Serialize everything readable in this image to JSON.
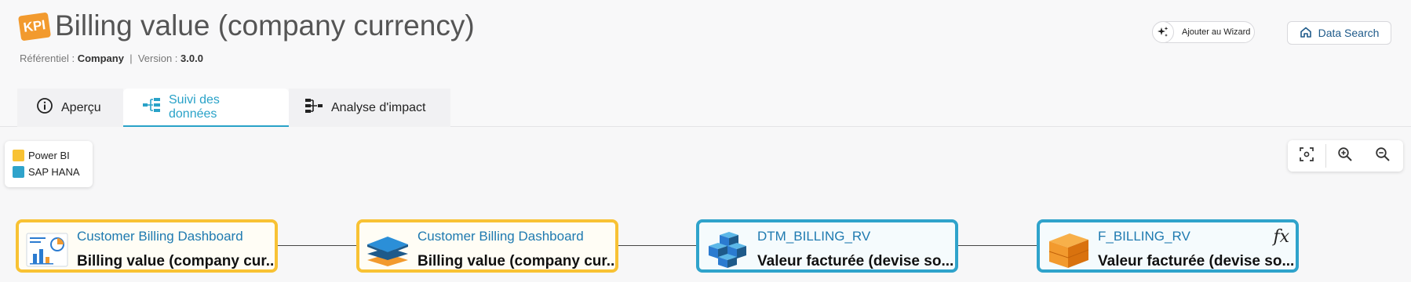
{
  "header": {
    "kpi_badge": "KPI",
    "title": "Billing value (company currency)",
    "referentiel_label": "Référentiel :",
    "referentiel_value": "Company",
    "separator": "|",
    "version_label": "Version :",
    "version_value": "3.0.0"
  },
  "actions": {
    "wizard_label": "Ajouter au Wizard",
    "search_label": "Data Search"
  },
  "tabs": [
    {
      "label": "Aperçu",
      "icon": "info-icon",
      "active": false
    },
    {
      "label": "Suivi des données",
      "icon": "lineage-icon",
      "active": true
    },
    {
      "label": "Analyse d'impact",
      "icon": "impact-icon",
      "active": false
    }
  ],
  "legend": [
    {
      "label": "Power BI",
      "color": "#f8c234"
    },
    {
      "label": "SAP HANA",
      "color": "#2fa3cb"
    }
  ],
  "zoom": {
    "fit_icon": "focus-icon",
    "zoom_in_icon": "zoom-in-icon",
    "zoom_out_icon": "zoom-out-icon"
  },
  "nodes": [
    {
      "title": "Customer Billing Dashboard",
      "subtitle": "Billing value (company cur...",
      "source": "Power BI",
      "icon": "report-chart-icon",
      "border": "#f8c234"
    },
    {
      "title": "Customer Billing Dashboard",
      "subtitle": "Billing value (company cur...",
      "source": "Power BI",
      "icon": "layers-icon",
      "border": "#f8c234"
    },
    {
      "title": "DTM_BILLING_RV",
      "subtitle": "Valeur facturée (devise so...",
      "source": "SAP HANA",
      "icon": "cubes-icon",
      "border": "#2fa3cb"
    },
    {
      "title": "F_BILLING_RV",
      "subtitle": "Valeur facturée (devise so...",
      "source": "SAP HANA",
      "icon": "orange-cube-icon",
      "border": "#2fa3cb",
      "badge": "fx"
    }
  ]
}
